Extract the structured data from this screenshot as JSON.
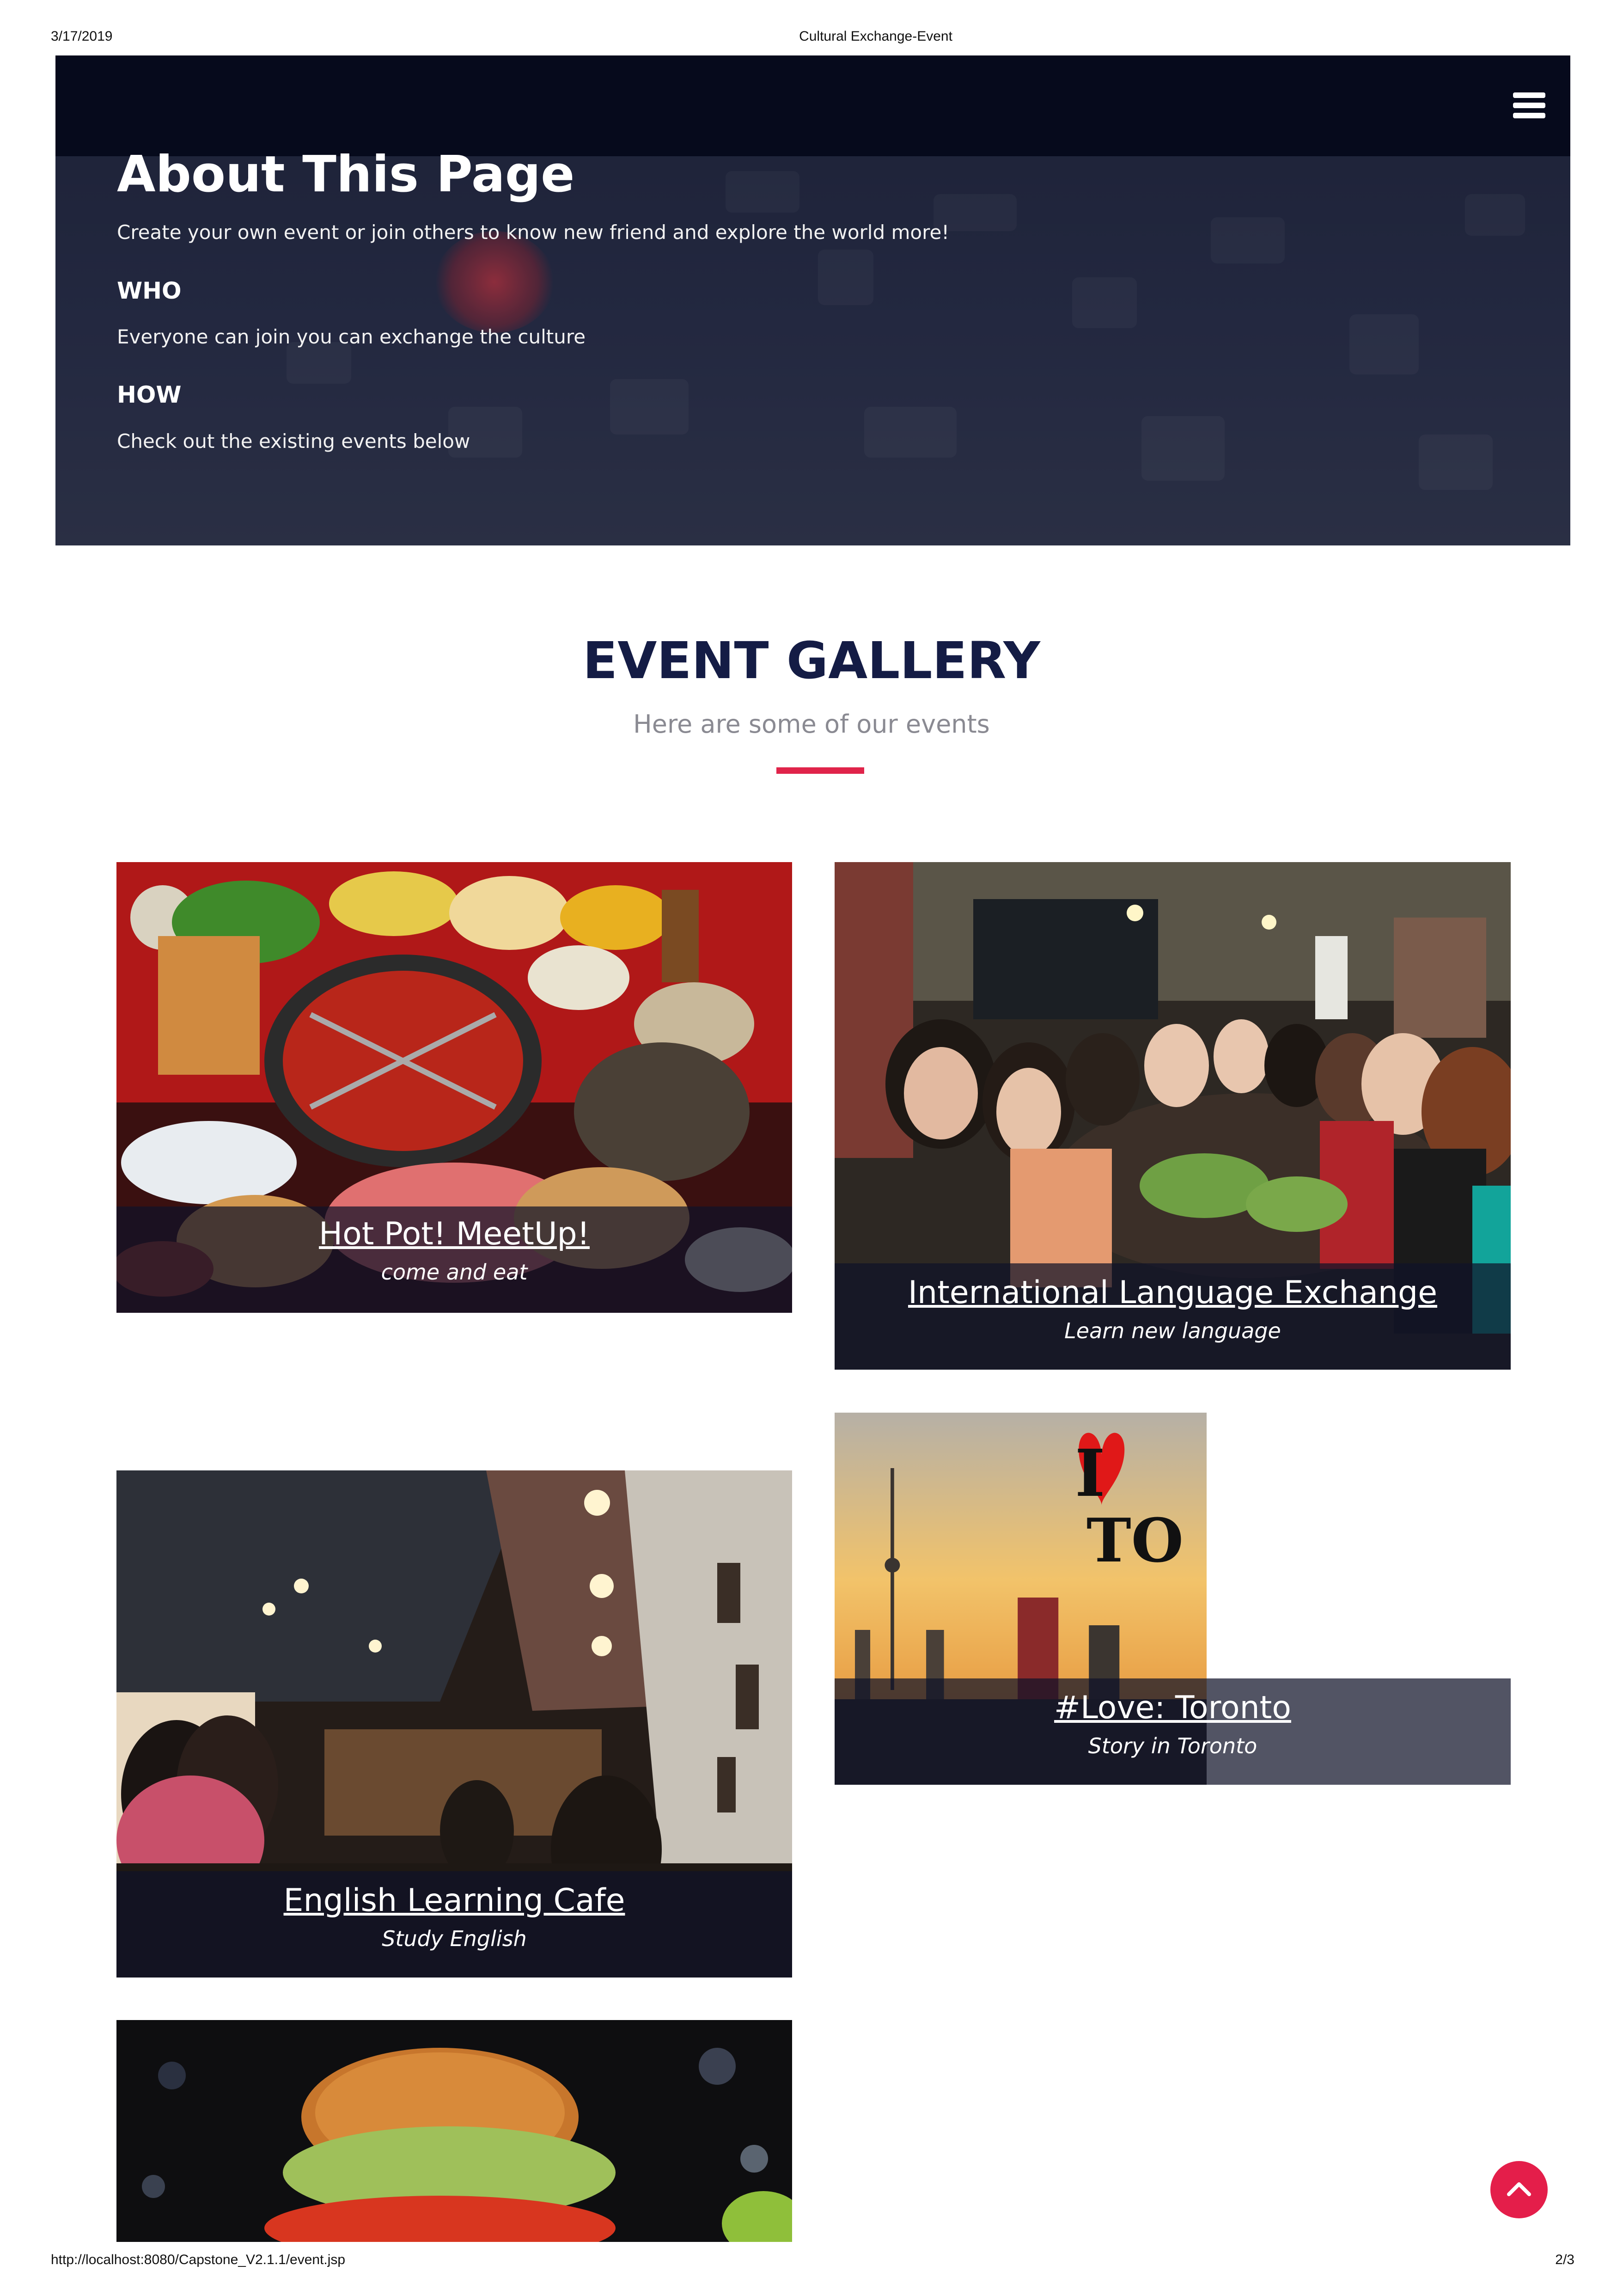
{
  "print_header": {
    "date": "3/17/2019",
    "title": "Cultural Exchange-Event"
  },
  "print_footer": {
    "url": "http://localhost:8080/Capstone_V2.1.1/event.jsp",
    "page": "2/3"
  },
  "navbar": {
    "menu_icon": "hamburger-menu-icon"
  },
  "about": {
    "title": "About This Page",
    "intro": "Create your own event or join others to know new friend and explore the world more!",
    "who_heading": "WHO",
    "who_text": "Everyone can join you can exchange the culture",
    "how_heading": "HOW",
    "how_text": "Check out the existing events below"
  },
  "gallery": {
    "title": "EVENT GALLERY",
    "subtitle": "Here are some of our events",
    "events": [
      {
        "title": "Hot Pot! MeetUp!",
        "subtitle": "come and eat"
      },
      {
        "title": "International Language Exchange",
        "subtitle": "Learn new language"
      },
      {
        "title": "#Love: Toronto",
        "subtitle": "Story in Toronto"
      },
      {
        "title": "English Learning Cafe",
        "subtitle": "Study English"
      },
      {
        "title": "",
        "subtitle": ""
      }
    ],
    "toronto_graphic": {
      "line1": "I",
      "line2": "TO"
    }
  },
  "scroll_top": {
    "icon": "chevron-up-icon",
    "color": "#e41e4a"
  },
  "colors": {
    "navbar": "#060a1c",
    "heading": "#141c45",
    "accent": "#e0244a"
  }
}
